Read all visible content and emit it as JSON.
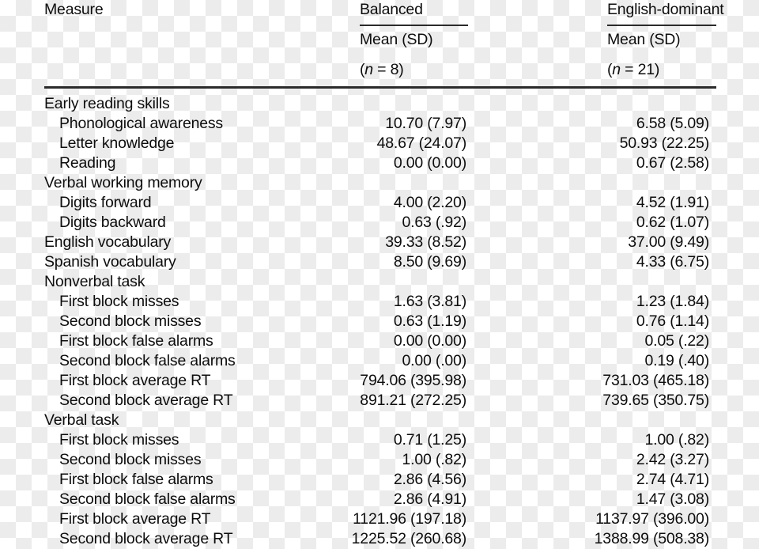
{
  "table": {
    "header": {
      "measure_label": "Measure",
      "groups": [
        {
          "label": "Balanced",
          "stat_label": "Mean (SD)",
          "n_prefix": "(",
          "n_italic": "n",
          "n_suffix": " = 8)"
        },
        {
          "label": "English-dominant",
          "stat_label": "Mean (SD)",
          "n_prefix": "(",
          "n_italic": "n",
          "n_suffix": " = 21)"
        }
      ]
    },
    "rows": [
      {
        "measure": "Early reading skills",
        "indent": false,
        "balanced": "",
        "english": ""
      },
      {
        "measure": "Phonological awareness",
        "indent": true,
        "balanced": "10.70 (7.97)",
        "english": "6.58 (5.09)"
      },
      {
        "measure": "Letter knowledge",
        "indent": true,
        "balanced": "48.67 (24.07)",
        "english": "50.93 (22.25)"
      },
      {
        "measure": "Reading",
        "indent": true,
        "balanced": "0.00 (0.00)",
        "english": "0.67 (2.58)"
      },
      {
        "measure": "Verbal working memory",
        "indent": false,
        "balanced": "",
        "english": ""
      },
      {
        "measure": "Digits forward",
        "indent": true,
        "balanced": "4.00 (2.20)",
        "english": "4.52 (1.91)"
      },
      {
        "measure": "Digits backward",
        "indent": true,
        "balanced": "0.63 (.92)",
        "english": "0.62 (1.07)"
      },
      {
        "measure": "English vocabulary",
        "indent": false,
        "balanced": "39.33 (8.52)",
        "english": "37.00 (9.49)"
      },
      {
        "measure": "Spanish vocabulary",
        "indent": false,
        "balanced": "8.50 (9.69)",
        "english": "4.33 (6.75)"
      },
      {
        "measure": "Nonverbal task",
        "indent": false,
        "balanced": "",
        "english": ""
      },
      {
        "measure": "First block misses",
        "indent": true,
        "balanced": "1.63 (3.81)",
        "english": "1.23 (1.84)"
      },
      {
        "measure": "Second block misses",
        "indent": true,
        "balanced": "0.63 (1.19)",
        "english": "0.76 (1.14)"
      },
      {
        "measure": "First block false alarms",
        "indent": true,
        "balanced": "0.00 (0.00)",
        "english": "0.05 (.22)"
      },
      {
        "measure": "Second block false alarms",
        "indent": true,
        "balanced": "0.00 (.00)",
        "english": "0.19 (.40)"
      },
      {
        "measure": "First block average RT",
        "indent": true,
        "balanced": "794.06 (395.98)",
        "english": "731.03 (465.18)"
      },
      {
        "measure": "Second block average RT",
        "indent": true,
        "balanced": "891.21 (272.25)",
        "english": "739.65 (350.75)"
      },
      {
        "measure": "Verbal task",
        "indent": false,
        "balanced": "",
        "english": ""
      },
      {
        "measure": "First block misses",
        "indent": true,
        "balanced": "0.71 (1.25)",
        "english": "1.00 (.82)"
      },
      {
        "measure": "Second block misses",
        "indent": true,
        "balanced": "1.00 (.82)",
        "english": "2.42 (3.27)"
      },
      {
        "measure": "First block false alarms",
        "indent": true,
        "balanced": "2.86 (4.56)",
        "english": "2.74 (4.71)"
      },
      {
        "measure": "Second block false alarms",
        "indent": true,
        "balanced": "2.86 (4.91)",
        "english": "1.47 (3.08)"
      },
      {
        "measure": "First block average RT",
        "indent": true,
        "balanced": "1121.96 (197.18)",
        "english": "1137.97 (396.00)"
      },
      {
        "measure": "Second block average RT",
        "indent": true,
        "balanced": "1225.52 (260.68)",
        "english": "1388.99 (508.38)"
      }
    ]
  },
  "colors": {
    "text": "#0d0d0d",
    "rule": "#2b2b2b",
    "checker_light": "#ffffff",
    "checker_dark": "#ececec"
  }
}
